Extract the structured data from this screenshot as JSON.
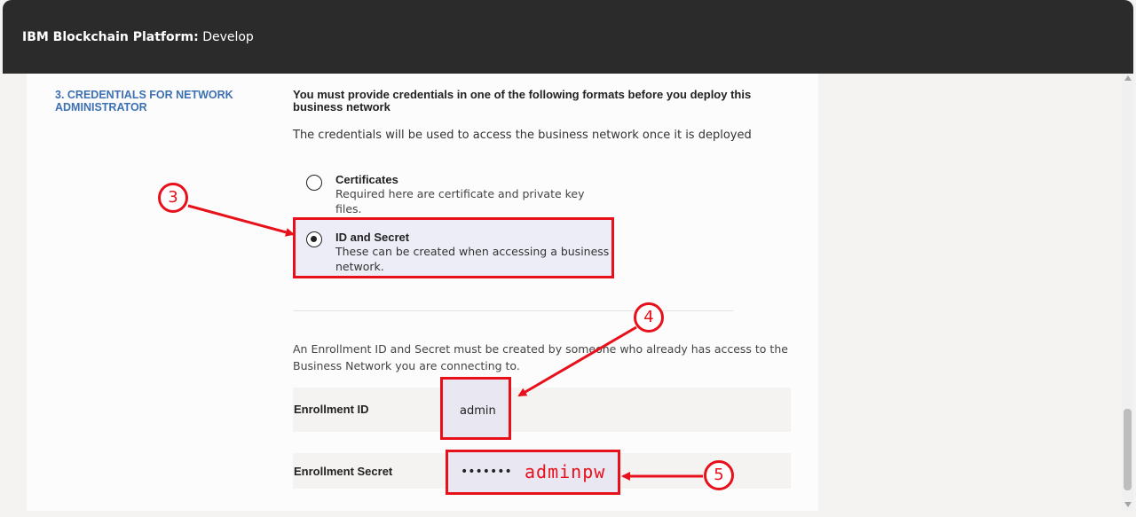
{
  "header": {
    "brand_bold": "IBM Blockchain Platform:",
    "brand_rest": "Develop"
  },
  "section": {
    "title": "3. CREDENTIALS FOR NETWORK ADMINISTRATOR"
  },
  "main": {
    "heading": "You must provide credentials in one of the following formats before you deploy this business network",
    "subtext": "The credentials will be used to access the business network once it is deployed"
  },
  "options": [
    {
      "title": "Certificates",
      "desc": "Required here are certificate and private key files.",
      "selected": false
    },
    {
      "title": "ID and Secret",
      "desc": "These can be created when accessing a business network.",
      "selected": true
    }
  ],
  "info_text": "An Enrollment ID and Secret must be created by someone who already has access to the Business Network you are connecting to.",
  "fields": {
    "enrollment_id": {
      "label": "Enrollment ID",
      "value": "admin"
    },
    "enrollment_secret": {
      "label": "Enrollment Secret",
      "masked": "•••••••",
      "annotation": "adminpw"
    }
  },
  "callouts": [
    "3",
    "4",
    "5"
  ],
  "colors": {
    "accent": "#3d70b2",
    "annotation": "#e8101a",
    "topbar": "#2b2b2b"
  }
}
